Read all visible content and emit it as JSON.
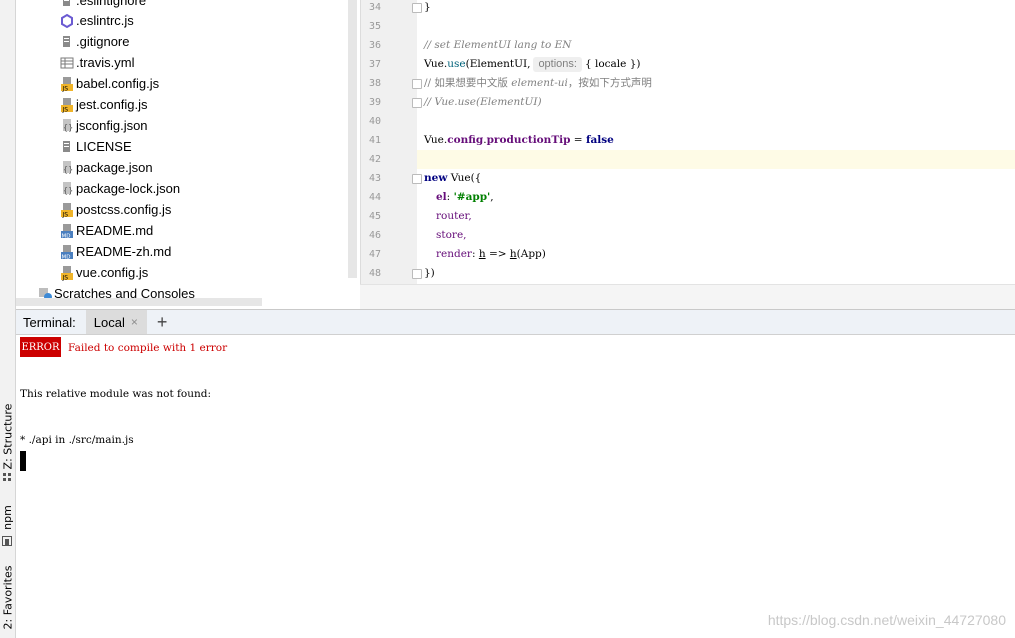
{
  "left_strip": {
    "tabs": [
      {
        "label": "Z: Structure"
      },
      {
        "label": "npm"
      },
      {
        "label": "2: Favorites"
      }
    ]
  },
  "project_tree": {
    "items": [
      {
        "name": ".eslintignore",
        "icon": "text-file-icon"
      },
      {
        "name": ".eslintrc.js",
        "icon": "eslint-icon"
      },
      {
        "name": ".gitignore",
        "icon": "text-file-icon"
      },
      {
        "name": ".travis.yml",
        "icon": "yml-file-icon"
      },
      {
        "name": "babel.config.js",
        "icon": "js-file-icon"
      },
      {
        "name": "jest.config.js",
        "icon": "js-file-icon"
      },
      {
        "name": "jsconfig.json",
        "icon": "json-file-icon"
      },
      {
        "name": "LICENSE",
        "icon": "text-file-icon"
      },
      {
        "name": "package.json",
        "icon": "json-file-icon"
      },
      {
        "name": "package-lock.json",
        "icon": "json-file-icon"
      },
      {
        "name": "postcss.config.js",
        "icon": "js-file-icon"
      },
      {
        "name": "README.md",
        "icon": "md-file-icon"
      },
      {
        "name": "README-zh.md",
        "icon": "md-file-icon"
      },
      {
        "name": "vue.config.js",
        "icon": "js-file-icon"
      }
    ],
    "scratches": "Scratches and Consoles"
  },
  "editor": {
    "line_numbers": [
      "34",
      "35",
      "36",
      "37",
      "38",
      "39",
      "40",
      "41",
      "42",
      "43",
      "44",
      "45",
      "46",
      "47",
      "48"
    ],
    "current_line": "42",
    "hint_label": "options:",
    "lines": {
      "l34": "}",
      "l36": "// set ElementUI lang to EN",
      "l37a": "Vue.",
      "l37b": "use",
      "l37c": "(ElementUI,",
      "l37d": "{ locale })",
      "l38a": "// 如果想要中文版 ",
      "l38b": "element-ui",
      "l38c": "，按如下方式声明",
      "l39": "// Vue.use(ElementUI)",
      "l41a": "Vue.",
      "l41b": "config",
      "l41c": ".",
      "l41d": "productionTip",
      "l41e": " = ",
      "l41f": "false",
      "l43a": "new",
      "l43b": " Vue({",
      "l44a": "el",
      "l44b": ": ",
      "l44c": "'#app'",
      "l44d": ",",
      "l45": "router,",
      "l46": "store,",
      "l47a": "render",
      "l47b": ": ",
      "l47c": "h",
      "l47d": " => ",
      "l47e": "h",
      "l47f": "(App)",
      "l48": "})"
    }
  },
  "terminal": {
    "title": "Terminal:",
    "tab_label": "Local",
    "close_glyph": "×",
    "add_glyph": "+",
    "error_badge": "ERROR",
    "error_message": "Failed to compile with 1 error",
    "line1": "This relative module was not found:",
    "line2": "* ./api in ./src/main.js"
  },
  "watermark": "https://blog.csdn.net/weixin_44727080"
}
